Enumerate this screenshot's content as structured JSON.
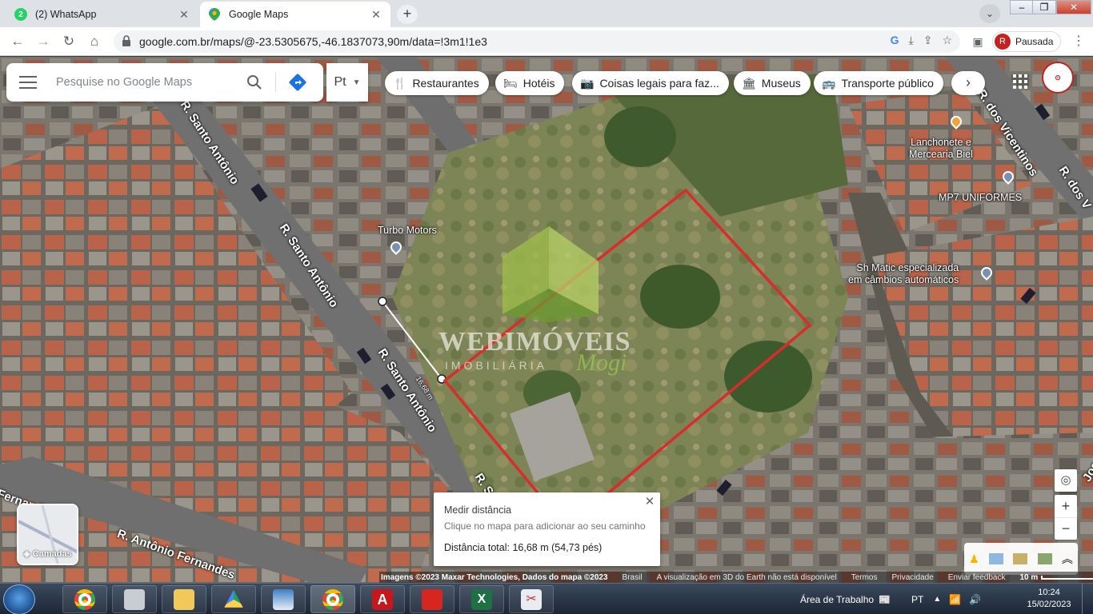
{
  "browser": {
    "tabs": [
      {
        "title": "(2) WhatsApp",
        "icon": "whatsapp-icon",
        "active": false
      },
      {
        "title": "Google Maps",
        "icon": "google-maps-icon",
        "active": true
      }
    ],
    "url": "google.com.br/maps/@-23.5305675,-46.1837073,90m/data=!3m1!1e3",
    "profile": {
      "initial": "R",
      "label": "Pausada"
    }
  },
  "maps": {
    "search_placeholder": "Pesquise no Google Maps",
    "language_button": "Pt",
    "chips": [
      {
        "label": "Restaurantes",
        "icon": "fork-knife-icon"
      },
      {
        "label": "Hotéis",
        "icon": "bed-icon"
      },
      {
        "label": "Coisas legais para faz...",
        "icon": "camera-icon"
      },
      {
        "label": "Museus",
        "icon": "museum-icon"
      },
      {
        "label": "Transporte público",
        "icon": "bus-icon"
      }
    ],
    "street_labels": [
      "R. Santo Antônio",
      "R. Santo Antônio",
      "R. Santo Antônio",
      "R. dos Vicentinos",
      "R. Antônio Fernandes",
      "R. S",
      "R. dos V",
      "Fernandes",
      "Jos"
    ],
    "pois": [
      {
        "name": "Turbo Motors"
      },
      {
        "name": "Lanchonete e\nMercearia Biel"
      },
      {
        "name": "MP7 UNIFORMES"
      },
      {
        "name": "Sh Matic especializada\nem câmbios automáticos"
      }
    ],
    "layers_label": "Camadas",
    "measure": {
      "title": "Medir distância",
      "hint": "Clique no mapa para adicionar ao seu caminho",
      "total": "Distância total: 16,68 m (54,73 pés)",
      "segment_label": "16,68 m"
    },
    "attribution": {
      "imagery": "Imagens ©2023 Maxar Technologies, Dados do mapa ©2023",
      "country": "Brasil",
      "notice": "A visualização em 3D do Earth não está disponível",
      "terms": "Termos",
      "privacy": "Privacidade",
      "feedback": "Enviar feedback",
      "scale": "10 m"
    },
    "watermark": {
      "line1": "WEBIMÓVEIS",
      "line2": "IMOBILIÁRIA",
      "line3": "Mogi"
    }
  },
  "taskbar": {
    "desktop_label": "Área de Trabalho",
    "language": "PT",
    "time": "10:24",
    "date": "15/02/2023"
  },
  "colors": {
    "measure_line": "#d92c2c",
    "chip_bg": "#ffffff",
    "pin_blue": "#7b8fae",
    "pin_orange": "#f2a33a"
  }
}
